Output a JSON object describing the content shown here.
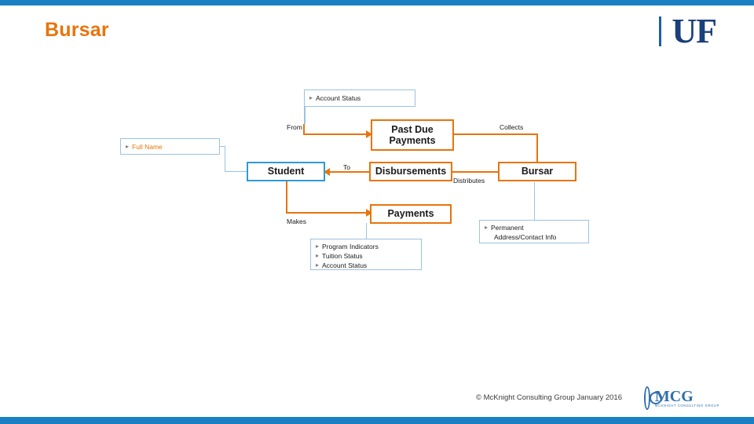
{
  "slide": {
    "title": "Bursar"
  },
  "brand": {
    "uf_logo_text": "UF",
    "uf_logo_name": "uf-logo"
  },
  "diagram": {
    "entities": [
      {
        "id": "student",
        "label": "Student",
        "style": "blue"
      },
      {
        "id": "past_due_payments",
        "label": "Past Due\nPayments",
        "style": "orange"
      },
      {
        "id": "disbursements",
        "label": "Disbursements",
        "style": "orange"
      },
      {
        "id": "bursar",
        "label": "Bursar",
        "style": "orange"
      },
      {
        "id": "payments",
        "label": "Payments",
        "style": "orange"
      }
    ],
    "attribute_boxes": [
      {
        "id": "account_status_top",
        "lines": [
          "Account Status"
        ]
      },
      {
        "id": "full_name",
        "lines": [
          "Full Name"
        ]
      },
      {
        "id": "student_attributes",
        "lines": [
          "Program Indicators",
          "Tuition Status",
          "Account Status"
        ]
      },
      {
        "id": "bursar_attributes",
        "lines": [
          "Permanent",
          "Address/Contact Info"
        ]
      }
    ],
    "edge_labels": [
      {
        "id": "from",
        "text": "From"
      },
      {
        "id": "to",
        "text": "To"
      },
      {
        "id": "collects",
        "text": "Collects"
      },
      {
        "id": "distributes",
        "text": "Distributes"
      },
      {
        "id": "makes",
        "text": "Makes"
      }
    ],
    "colors": {
      "accent_orange": "#e8740c",
      "accent_blue": "#2e9bd6",
      "bar_blue": "#1b7fc4",
      "attr_border": "#9cc3e0"
    }
  },
  "footer": {
    "copyright": "© McKnight Consulting Group January 2016",
    "mcg_word": "MCG",
    "mcg_sub": "MCKNIGHT CONSULTING GROUP"
  }
}
